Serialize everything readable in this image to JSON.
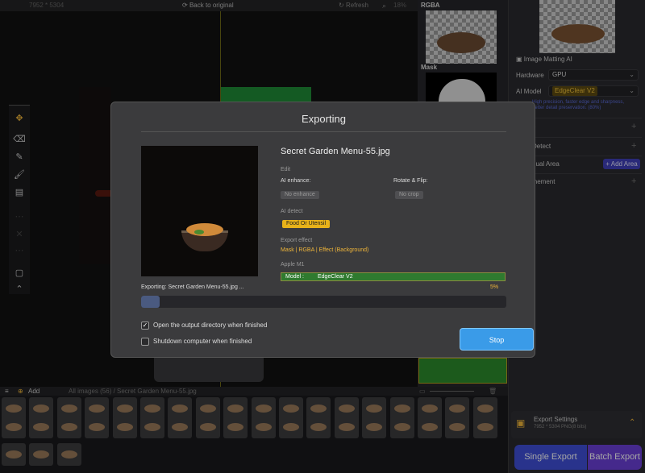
{
  "topbar": {
    "dimensions": "7952 * 5304",
    "back_label": "Back to original",
    "refresh_label": "Refresh",
    "zoom": "18%"
  },
  "preview": {
    "rgba_label": "RGBA",
    "mask_label": "Mask"
  },
  "right_panel": {
    "section_title": "Image Matting AI",
    "hardware_label": "Hardware",
    "hardware_value": "GPU",
    "model_label": "AI Model",
    "model_value": "EdgeClear",
    "model_version": "V2",
    "model_desc": "High precision, faster edge and sharpness, better detail preservation. (80%)",
    "partial_items": [
      {
        "label": "e"
      },
      {
        "label": "Detect"
      },
      {
        "label": "nual Area"
      },
      {
        "label": "inement"
      }
    ],
    "add_area_label": "Add Area",
    "export_settings_title": "Export Settings",
    "export_settings_detail": "7952 * 5304 PNG(8 bits)",
    "single_export_label": "Single Export",
    "batch_export_label": "Batch Export"
  },
  "filmstrip": {
    "add_label": "Add",
    "breadcrumb": "All images (56) / Secret Garden Menu-55.jpg"
  },
  "dialog": {
    "title": "Exporting",
    "filename": "Secret Garden Menu-55.jpg",
    "edit_section": "Edit",
    "ai_enhance_label": "AI enhance:",
    "ai_enhance_value": "No enhance",
    "rotate_label": "Rotate & Flip:",
    "rotate_value": "No crop",
    "ai_detect_section": "AI detect",
    "ai_detect_value": "Food Or Utensil",
    "export_effect_section": "Export effect",
    "export_effect_value": "Mask | RGBA | Effect (Background)",
    "device_section": "Apple M1",
    "model_key": "Model :",
    "model_value": "EdgeClear  V2",
    "exporting_text": "Exporting: Secret Garden Menu-55.jpg ...",
    "percent_text": "5%",
    "progress_fraction": 0.05,
    "open_dir_label": "Open the output directory when finished",
    "open_dir_checked": true,
    "shutdown_label": "Shutdown computer when finished",
    "shutdown_checked": false,
    "stop_label": "Stop"
  },
  "colors": {
    "accent_blue": "#3a9be8",
    "accent_yellow": "#f0b63a",
    "progress_green": "#2f7a2f"
  }
}
